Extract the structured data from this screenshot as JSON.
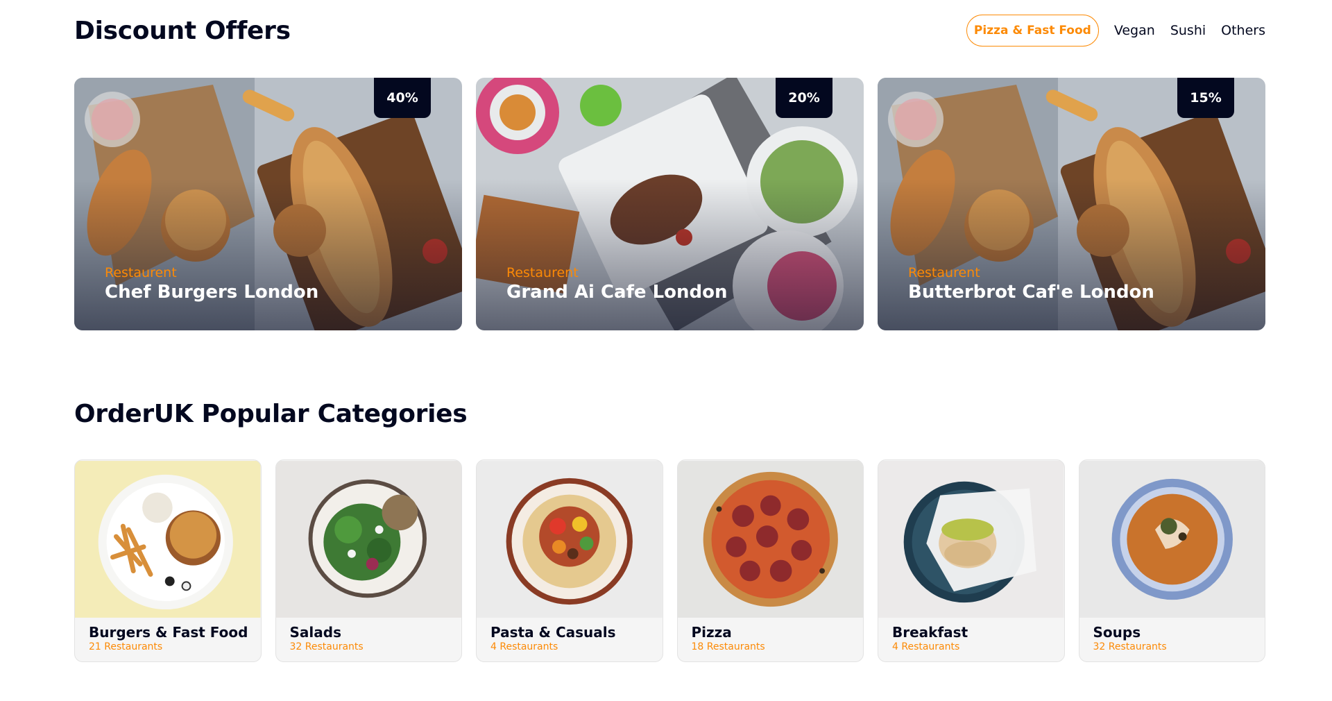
{
  "offers": {
    "title": "Discount Offers",
    "tabs": [
      {
        "label": "Pizza & Fast Food",
        "active": true
      },
      {
        "label": "Vegan",
        "active": false
      },
      {
        "label": "Sushi",
        "active": false
      },
      {
        "label": "Others",
        "active": false
      }
    ],
    "cards": [
      {
        "badge": "40%",
        "kind": "Restaurent",
        "name": "Chef Burgers London",
        "image": "burgers-sandwiches-photo"
      },
      {
        "badge": "20%",
        "kind": "Restaurent",
        "name": "Grand Ai Cafe London",
        "image": "steak-salads-photo"
      },
      {
        "badge": "15%",
        "kind": "Restaurent",
        "name": "Butterbrot Caf'e London",
        "image": "burgers-sandwiches-photo"
      }
    ]
  },
  "categories": {
    "title": "OrderUK Popular Categories",
    "items": [
      {
        "name": "Burgers & Fast Food",
        "count": "21 Restaurants",
        "image": "burger-fries-plate-photo"
      },
      {
        "name": "Salads",
        "count": "32 Restaurants",
        "image": "salad-bowl-photo"
      },
      {
        "name": "Pasta & Casuals",
        "count": "4 Restaurants",
        "image": "pasta-plate-photo"
      },
      {
        "name": "Pizza",
        "count": "18 Restaurants",
        "image": "pepperoni-pizza-photo"
      },
      {
        "name": "Breakfast",
        "count": "4 Restaurants",
        "image": "breakfast-bagel-photo"
      },
      {
        "name": "Soups",
        "count": "32 Restaurants",
        "image": "soup-bowl-photo"
      }
    ]
  },
  "colors": {
    "accent": "#FC8A06",
    "dark": "#03081F",
    "card_bg": "#F5F5F5"
  }
}
